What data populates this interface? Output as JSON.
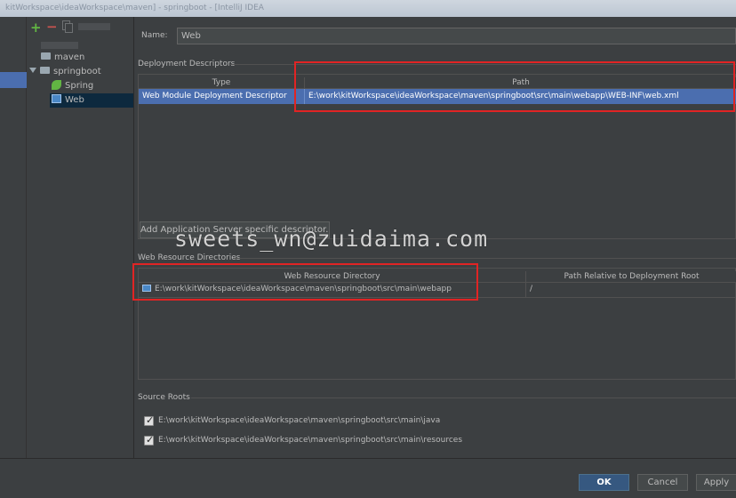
{
  "window": {
    "title": "kitWorkspace\\ideaWorkspace\\maven] - springboot - [IntelliJ IDEA"
  },
  "tree": {
    "add_icon": "+",
    "remove_icon": "−",
    "items": [
      {
        "label": "maven",
        "icon": "folder-icon"
      },
      {
        "label": "springboot",
        "icon": "folder-icon"
      },
      {
        "label": "Spring",
        "icon": "spring-icon"
      },
      {
        "label": "Web",
        "icon": "web-icon"
      }
    ]
  },
  "form": {
    "name_label": "Name:",
    "name_value": "Web"
  },
  "descriptors": {
    "section_title": "Deployment Descriptors",
    "columns": [
      "Type",
      "Path"
    ],
    "rows": [
      {
        "type": "Web Module Deployment Descriptor",
        "path": "E:\\work\\kitWorkspace\\ideaWorkspace\\maven\\springboot\\src\\main\\webapp\\WEB-INF\\web.xml"
      }
    ],
    "add_button": "Add Application Server specific descriptor..."
  },
  "resources": {
    "section_title": "Web Resource Directories",
    "columns": [
      "Web Resource Directory",
      "Path Relative to Deployment Root"
    ],
    "rows": [
      {
        "directory": "E:\\work\\kitWorkspace\\ideaWorkspace\\maven\\springboot\\src\\main\\webapp",
        "relative": "/"
      }
    ]
  },
  "source_roots": {
    "section_title": "Source Roots",
    "items": [
      {
        "path": "E:\\work\\kitWorkspace\\ideaWorkspace\\maven\\springboot\\src\\main\\java",
        "checked": true
      },
      {
        "path": "E:\\work\\kitWorkspace\\ideaWorkspace\\maven\\springboot\\src\\main\\resources",
        "checked": true
      }
    ]
  },
  "watermark": "sweets_wn@zuidaima.com",
  "buttons": {
    "ok": "OK",
    "cancel": "Cancel",
    "apply": "Apply"
  },
  "colors": {
    "accent": "#4b6eaf",
    "highlight": "#e02424",
    "ok_button": "#365880"
  }
}
